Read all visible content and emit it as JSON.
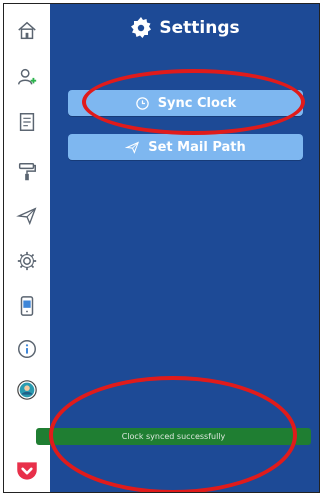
{
  "header": {
    "title": "Settings",
    "icon": "gear-icon"
  },
  "buttons": {
    "sync_clock": "Sync Clock",
    "set_mail_path": "Set Mail Path"
  },
  "toast": {
    "message": "Clock synced successfully"
  },
  "sidebar": {
    "items": [
      {
        "icon": "home-icon"
      },
      {
        "icon": "add-user-icon"
      },
      {
        "icon": "document-icon"
      },
      {
        "icon": "paint-roller-icon"
      },
      {
        "icon": "paper-plane-icon"
      },
      {
        "icon": "gear-icon"
      },
      {
        "icon": "tablet-icon"
      },
      {
        "icon": "info-icon"
      },
      {
        "icon": "user-icon"
      },
      {
        "icon": "pocket-icon"
      }
    ]
  },
  "colors": {
    "main_bg": "#1d4a96",
    "button_bg": "#7eb7f0",
    "toast_bg": "#1f7e32",
    "highlight": "#e01b1b",
    "pocket": "#e8304a"
  }
}
